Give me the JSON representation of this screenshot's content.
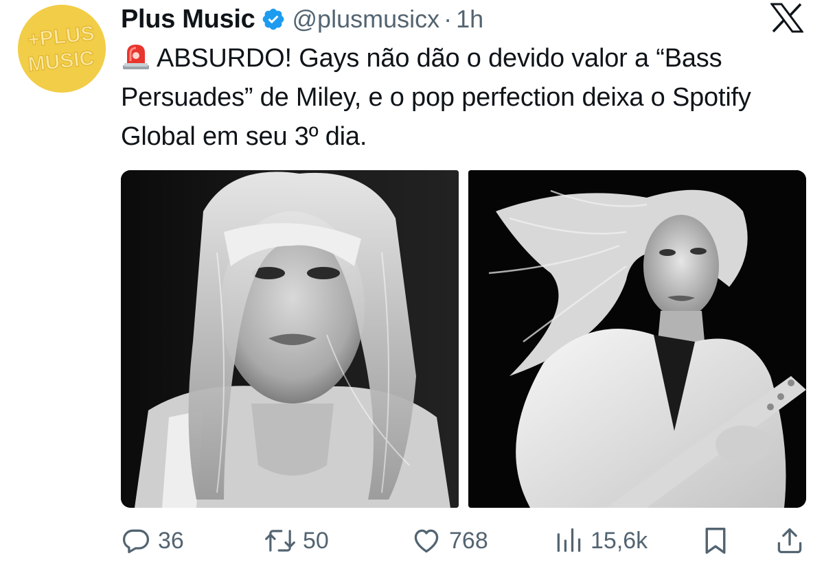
{
  "author": {
    "avatar_text_line1": "+PLUS",
    "avatar_text_line2": "MUSIC",
    "name": "Plus Music",
    "handle": "@plusmusicx",
    "separator": "·",
    "time": "1h",
    "verified": true
  },
  "platform_icon": "x-logo-icon",
  "tweet": {
    "emoji_icon": "police-siren-icon",
    "text": "ABSURDO! Gays não dão o devido valor a “Bass Persuades” de Miley, e o pop perfection deixa o Spotify Global em seu 3º dia."
  },
  "media": {
    "photos": [
      {
        "icon": "photo-portrait-icon"
      },
      {
        "icon": "photo-guitar-performance-icon"
      }
    ]
  },
  "actions": {
    "replies": {
      "icon": "reply-icon",
      "count": "36"
    },
    "reposts": {
      "icon": "repost-icon",
      "count": "50"
    },
    "likes": {
      "icon": "heart-icon",
      "count": "768"
    },
    "views": {
      "icon": "views-icon",
      "count": "15,6k"
    },
    "bookmark": {
      "icon": "bookmark-icon"
    },
    "share": {
      "icon": "share-icon"
    }
  },
  "colors": {
    "text": "#0f1419",
    "secondary": "#536471",
    "verified": "#1d9bf0",
    "avatar_bg": "#f2cd47"
  }
}
